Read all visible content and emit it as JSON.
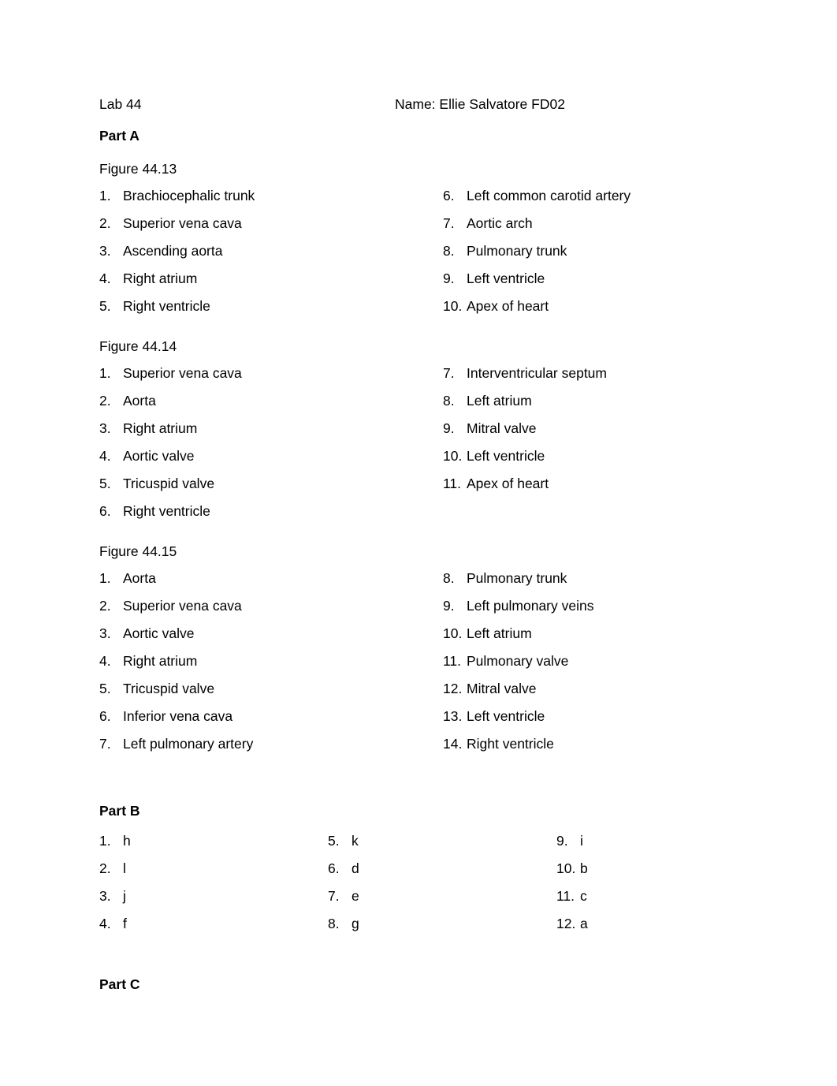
{
  "header": {
    "lab": "Lab 44",
    "name": "Name: Ellie Salvatore FD02"
  },
  "part_a": {
    "heading": "Part A",
    "figures": [
      {
        "heading": "Figure 44.13",
        "left": [
          {
            "num": "1.",
            "label": "Brachiocephalic trunk"
          },
          {
            "num": "2.",
            "label": "Superior vena cava"
          },
          {
            "num": "3.",
            "label": "Ascending aorta"
          },
          {
            "num": "4.",
            "label": "Right atrium"
          },
          {
            "num": "5.",
            "label": "Right ventricle"
          }
        ],
        "right": [
          {
            "num": "6.",
            "label": "Left common carotid artery"
          },
          {
            "num": "7.",
            "label": "Aortic arch"
          },
          {
            "num": "8.",
            "label": "Pulmonary trunk"
          },
          {
            "num": "9.",
            "label": "Left ventricle"
          },
          {
            "num": "10.",
            "label": "Apex of heart"
          }
        ]
      },
      {
        "heading": "Figure 44.14",
        "left": [
          {
            "num": "1.",
            "label": "Superior vena cava"
          },
          {
            "num": "2.",
            "label": "Aorta"
          },
          {
            "num": "3.",
            "label": "Right atrium"
          },
          {
            "num": "4.",
            "label": "Aortic valve"
          },
          {
            "num": "5.",
            "label": "Tricuspid valve"
          },
          {
            "num": "6.",
            "label": "Right ventricle"
          }
        ],
        "right": [
          {
            "num": "7.",
            "label": "Interventricular septum"
          },
          {
            "num": "8.",
            "label": "Left atrium"
          },
          {
            "num": "9.",
            "label": "Mitral valve"
          },
          {
            "num": "10.",
            "label": "Left ventricle"
          },
          {
            "num": "11.",
            "label": "Apex of heart"
          }
        ]
      },
      {
        "heading": "Figure 44.15",
        "left": [
          {
            "num": "1.",
            "label": "Aorta"
          },
          {
            "num": "2.",
            "label": "Superior vena cava"
          },
          {
            "num": "3.",
            "label": "Aortic valve"
          },
          {
            "num": "4.",
            "label": "Right atrium"
          },
          {
            "num": "5.",
            "label": "Tricuspid valve"
          },
          {
            "num": "6.",
            "label": "Inferior vena cava"
          },
          {
            "num": "7.",
            "label": "Left pulmonary artery"
          }
        ],
        "right": [
          {
            "num": "8.",
            "label": "Pulmonary trunk"
          },
          {
            "num": "9.",
            "label": "Left pulmonary veins"
          },
          {
            "num": "10.",
            "label": "Left atrium"
          },
          {
            "num": "11.",
            "label": "Pulmonary valve"
          },
          {
            "num": "12.",
            "label": "Mitral valve"
          },
          {
            "num": "13.",
            "label": "Left ventricle"
          },
          {
            "num": "14.",
            "label": "Right ventricle"
          }
        ]
      }
    ]
  },
  "part_b": {
    "heading": "Part B",
    "col1": [
      {
        "num": "1.",
        "answer": "h"
      },
      {
        "num": "2.",
        "answer": "l"
      },
      {
        "num": "3.",
        "answer": "j"
      },
      {
        "num": "4.",
        "answer": "f"
      }
    ],
    "col2": [
      {
        "num": "5.",
        "answer": "k"
      },
      {
        "num": "6.",
        "answer": "d"
      },
      {
        "num": "7.",
        "answer": "e"
      },
      {
        "num": "8.",
        "answer": "g"
      }
    ],
    "col3": [
      {
        "num": "9.",
        "answer": "i"
      },
      {
        "num": "10.",
        "answer": "b"
      },
      {
        "num": "11.",
        "answer": "c"
      },
      {
        "num": "12.",
        "answer": "a"
      }
    ]
  },
  "part_c": {
    "heading": "Part C"
  }
}
